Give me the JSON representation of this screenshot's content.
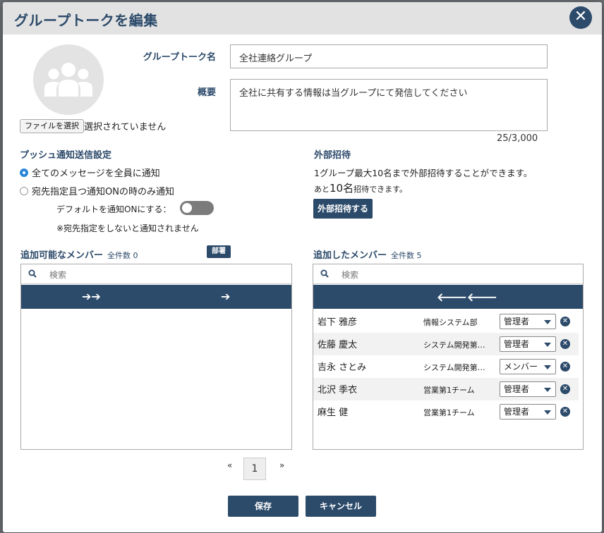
{
  "modal": {
    "title": "グループトークを編集",
    "close_symbol": "✕"
  },
  "avatar": {
    "icon": "group-icon"
  },
  "file": {
    "button_label": "ファイルを選択",
    "status": "選択されていません"
  },
  "form": {
    "name_label": "グループトーク名",
    "name_value": "全社連絡グループ",
    "summary_label": "概要",
    "summary_value": "全社に共有する情報は当グループにて発信してください",
    "counter": "25/3,000"
  },
  "push": {
    "title": "プッシュ通知送信設定",
    "option_all": "全てのメッセージを全員に通知",
    "option_mention": "宛先指定且つ通知ONの時のみ通知",
    "default_label": "デフォルトを通知ONにする：",
    "note": "※宛先指定をしないと通知されません",
    "selected": "all",
    "default_on": false
  },
  "external": {
    "title": "外部招待",
    "desc": "1グループ最大10名まで外部招待することができます。",
    "remaining_prefix": "あと",
    "remaining_count": "10名",
    "remaining_suffix": "招待できます。",
    "button_label": "外部招待する"
  },
  "available": {
    "title": "追加可能なメンバー",
    "count": "全件数 0",
    "dept_tag": "部署",
    "search_placeholder": "検索",
    "add_all_symbol": "➔➔",
    "add_one_symbol": "➔"
  },
  "added": {
    "title": "追加したメンバー",
    "count": "全件数 5",
    "search_placeholder": "検索",
    "remove_symbol": "🡐🡐",
    "members": [
      {
        "name": "岩下 雅彦",
        "dept": "情報システム部",
        "role": "管理者"
      },
      {
        "name": "佐藤 慶太",
        "dept": "システム開発第…",
        "role": "管理者"
      },
      {
        "name": "吉永 さとみ",
        "dept": "システム開発第…",
        "role": "メンバー"
      },
      {
        "name": "北沢 季衣",
        "dept": "営業第1チーム",
        "role": "管理者"
      },
      {
        "name": "麻生 健",
        "dept": "営業第1チーム",
        "role": "管理者"
      }
    ]
  },
  "pagination": {
    "prev": "«",
    "current": "1",
    "next": "»"
  },
  "footer": {
    "save_label": "保存",
    "cancel_label": "キャンセル"
  },
  "colors": {
    "primary": "#2c4a6a",
    "radio_checked": "#2a86d8"
  }
}
